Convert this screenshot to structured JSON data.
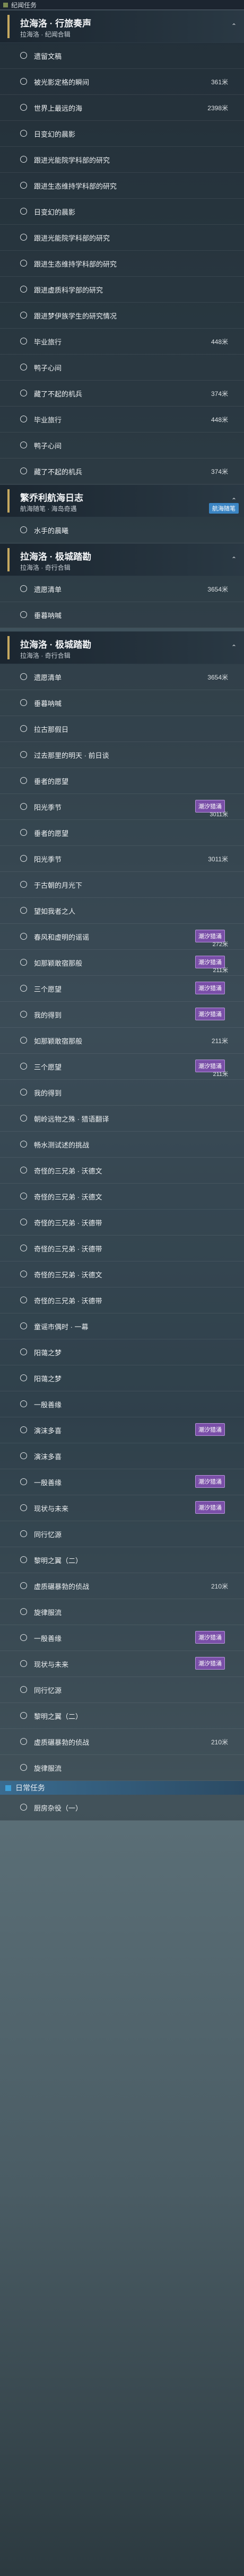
{
  "quest_category": "纪闻任务",
  "daily_category": "日常任务",
  "daily_first": "厨房杂役（一）",
  "groups": [
    {
      "title": "拉海洛 · 行旅奏声",
      "subtitle": "拉海洛 · 纪闻合辑",
      "rows": [
        {
          "label": "遗留文稿",
          "dist": ""
        },
        {
          "label": "被光影定格的瞬间",
          "dist": "361米"
        },
        {
          "label": "世界上最远的海",
          "dist": "2398米"
        },
        {
          "label": "日变幻的晨影",
          "dist": ""
        },
        {
          "label": "跟进光能院学科部的研究",
          "dist": ""
        },
        {
          "label": "跟进生态维持学科部的研究",
          "dist": ""
        },
        {
          "label": "日变幻的晨影",
          "dist": ""
        },
        {
          "label": "跟进光能院学科部的研究",
          "dist": ""
        },
        {
          "label": "跟进生态维持学科部的研究",
          "dist": ""
        },
        {
          "label": "跟进虚质科学部的研究",
          "dist": ""
        },
        {
          "label": "跟进梦伊族学生的研究情况",
          "dist": ""
        },
        {
          "label": "毕业旅行",
          "dist": "448米"
        },
        {
          "label": "鸭子心间",
          "dist": ""
        },
        {
          "label": "藏了不起的机兵",
          "dist": "374米"
        }
      ]
    }
  ],
  "middle_rows": [
    {
      "label": "毕业旅行",
      "dist": "448米"
    },
    {
      "label": "鸭子心间",
      "dist": ""
    },
    {
      "label": "藏了不起的机兵",
      "dist": "374米"
    }
  ],
  "group_b": {
    "title": "繁乔利航海日志",
    "subtitle": "航海随笔 · 海岛奇遇",
    "tag": "航海随笔"
  },
  "group_b_rows": [
    {
      "label": "水手的晨曦",
      "dist": ""
    }
  ],
  "group_c": {
    "title": "拉海洛 · 极城踏勘",
    "subtitle": "拉海洛 · 奇行合辑"
  },
  "group_c_rows": [
    {
      "label": "遗愿清单",
      "dist": "3654米"
    },
    {
      "label": "垂暮呐喊",
      "dist": ""
    }
  ],
  "group_d": {
    "title": "拉海洛 · 极城踏勘",
    "subtitle": "拉海洛 · 奇行合辑"
  },
  "group_d_rows": [
    {
      "label": "遗愿清单",
      "dist": "3654米",
      "badge": ""
    },
    {
      "label": "垂暮呐喊",
      "dist": "",
      "badge": ""
    },
    {
      "label": "拉古那假日",
      "dist": "",
      "badge": ""
    },
    {
      "label": "过去那里的明天 · 前日谈",
      "dist": "",
      "badge": ""
    },
    {
      "label": "垂者的愿望",
      "dist": "",
      "badge": ""
    },
    {
      "label": "阳光季节",
      "dist": "3011米",
      "badge": "潮汐猎涌"
    },
    {
      "label": "垂者的愿望",
      "dist": "",
      "badge": ""
    },
    {
      "label": "阳光季节",
      "dist": "3011米",
      "badge": ""
    },
    {
      "label": "于古朝的月光下",
      "dist": "",
      "badge": ""
    },
    {
      "label": "望如我者之人",
      "dist": "",
      "badge": ""
    },
    {
      "label": "春风和虚明的谣谣",
      "dist": "272米",
      "badge": "潮汐猎涌"
    },
    {
      "label": "如那颖敢宿那般",
      "dist": "211米",
      "badge": "潮汐猎涌"
    },
    {
      "label": "三个愿望",
      "dist": "",
      "badge": "潮汐猎涌"
    },
    {
      "label": "我的得到",
      "dist": "",
      "badge": "潮汐猎涌"
    },
    {
      "label": "如那颖敢宿那般",
      "dist": "211米",
      "badge": ""
    },
    {
      "label": "三个愿望",
      "dist": "211米",
      "badge": "潮汐猎涌"
    },
    {
      "label": "我的得到",
      "dist": "",
      "badge": ""
    },
    {
      "label": "朝岭远物之殊 · 猎语翻译",
      "dist": "",
      "badge": ""
    },
    {
      "label": "畅水测试述的挑战",
      "dist": "",
      "badge": ""
    },
    {
      "label": "奇怪的三兄弟 · 沃德文",
      "dist": "",
      "badge": ""
    },
    {
      "label": "奇怪的三兄弟 · 沃德文",
      "dist": "",
      "badge": ""
    },
    {
      "label": "奇怪的三兄弟 · 沃德带",
      "dist": "",
      "badge": ""
    },
    {
      "label": "奇怪的三兄弟 · 沃德带",
      "dist": "",
      "badge": ""
    },
    {
      "label": "奇怪的三兄弟 · 沃德文",
      "dist": "",
      "badge": ""
    },
    {
      "label": "奇怪的三兄弟 · 沃德带",
      "dist": "",
      "badge": ""
    },
    {
      "label": "童谣市偶时 · 一幕",
      "dist": "",
      "badge": ""
    },
    {
      "label": "阳蔼之梦",
      "dist": "",
      "badge": ""
    },
    {
      "label": "阳蔼之梦",
      "dist": "",
      "badge": ""
    },
    {
      "label": "一殷善缘",
      "dist": "",
      "badge": ""
    },
    {
      "label": "演沫多喜",
      "dist": "",
      "badge": "潮汐猎涌"
    },
    {
      "label": "演沫多喜",
      "dist": "",
      "badge": ""
    },
    {
      "label": "一殷善缘",
      "dist": "",
      "badge": "潮汐猎涌"
    },
    {
      "label": "现状与未来",
      "dist": "",
      "badge": "潮汐猎涌"
    },
    {
      "label": "同行忆源",
      "dist": "",
      "badge": ""
    },
    {
      "label": "黎明之翼（二）",
      "dist": "",
      "badge": ""
    },
    {
      "label": "虚质碾暴勃的侦战",
      "dist": "210米",
      "badge": ""
    },
    {
      "label": "旋律服流",
      "dist": "",
      "badge": ""
    }
  ],
  "tail_rows": [
    {
      "label": "一殷善缘",
      "dist": "",
      "badge": "潮汐猎涌"
    },
    {
      "label": "现状与未来",
      "dist": "",
      "badge": "潮汐猎涌"
    },
    {
      "label": "同行忆源",
      "dist": "",
      "badge": ""
    },
    {
      "label": "黎明之翼（二）",
      "dist": "",
      "badge": ""
    },
    {
      "label": "虚质碾暴勃的侦战",
      "dist": "210米",
      "badge": ""
    },
    {
      "label": "旋律服流",
      "dist": "",
      "badge": ""
    }
  ],
  "caret": "⌃"
}
